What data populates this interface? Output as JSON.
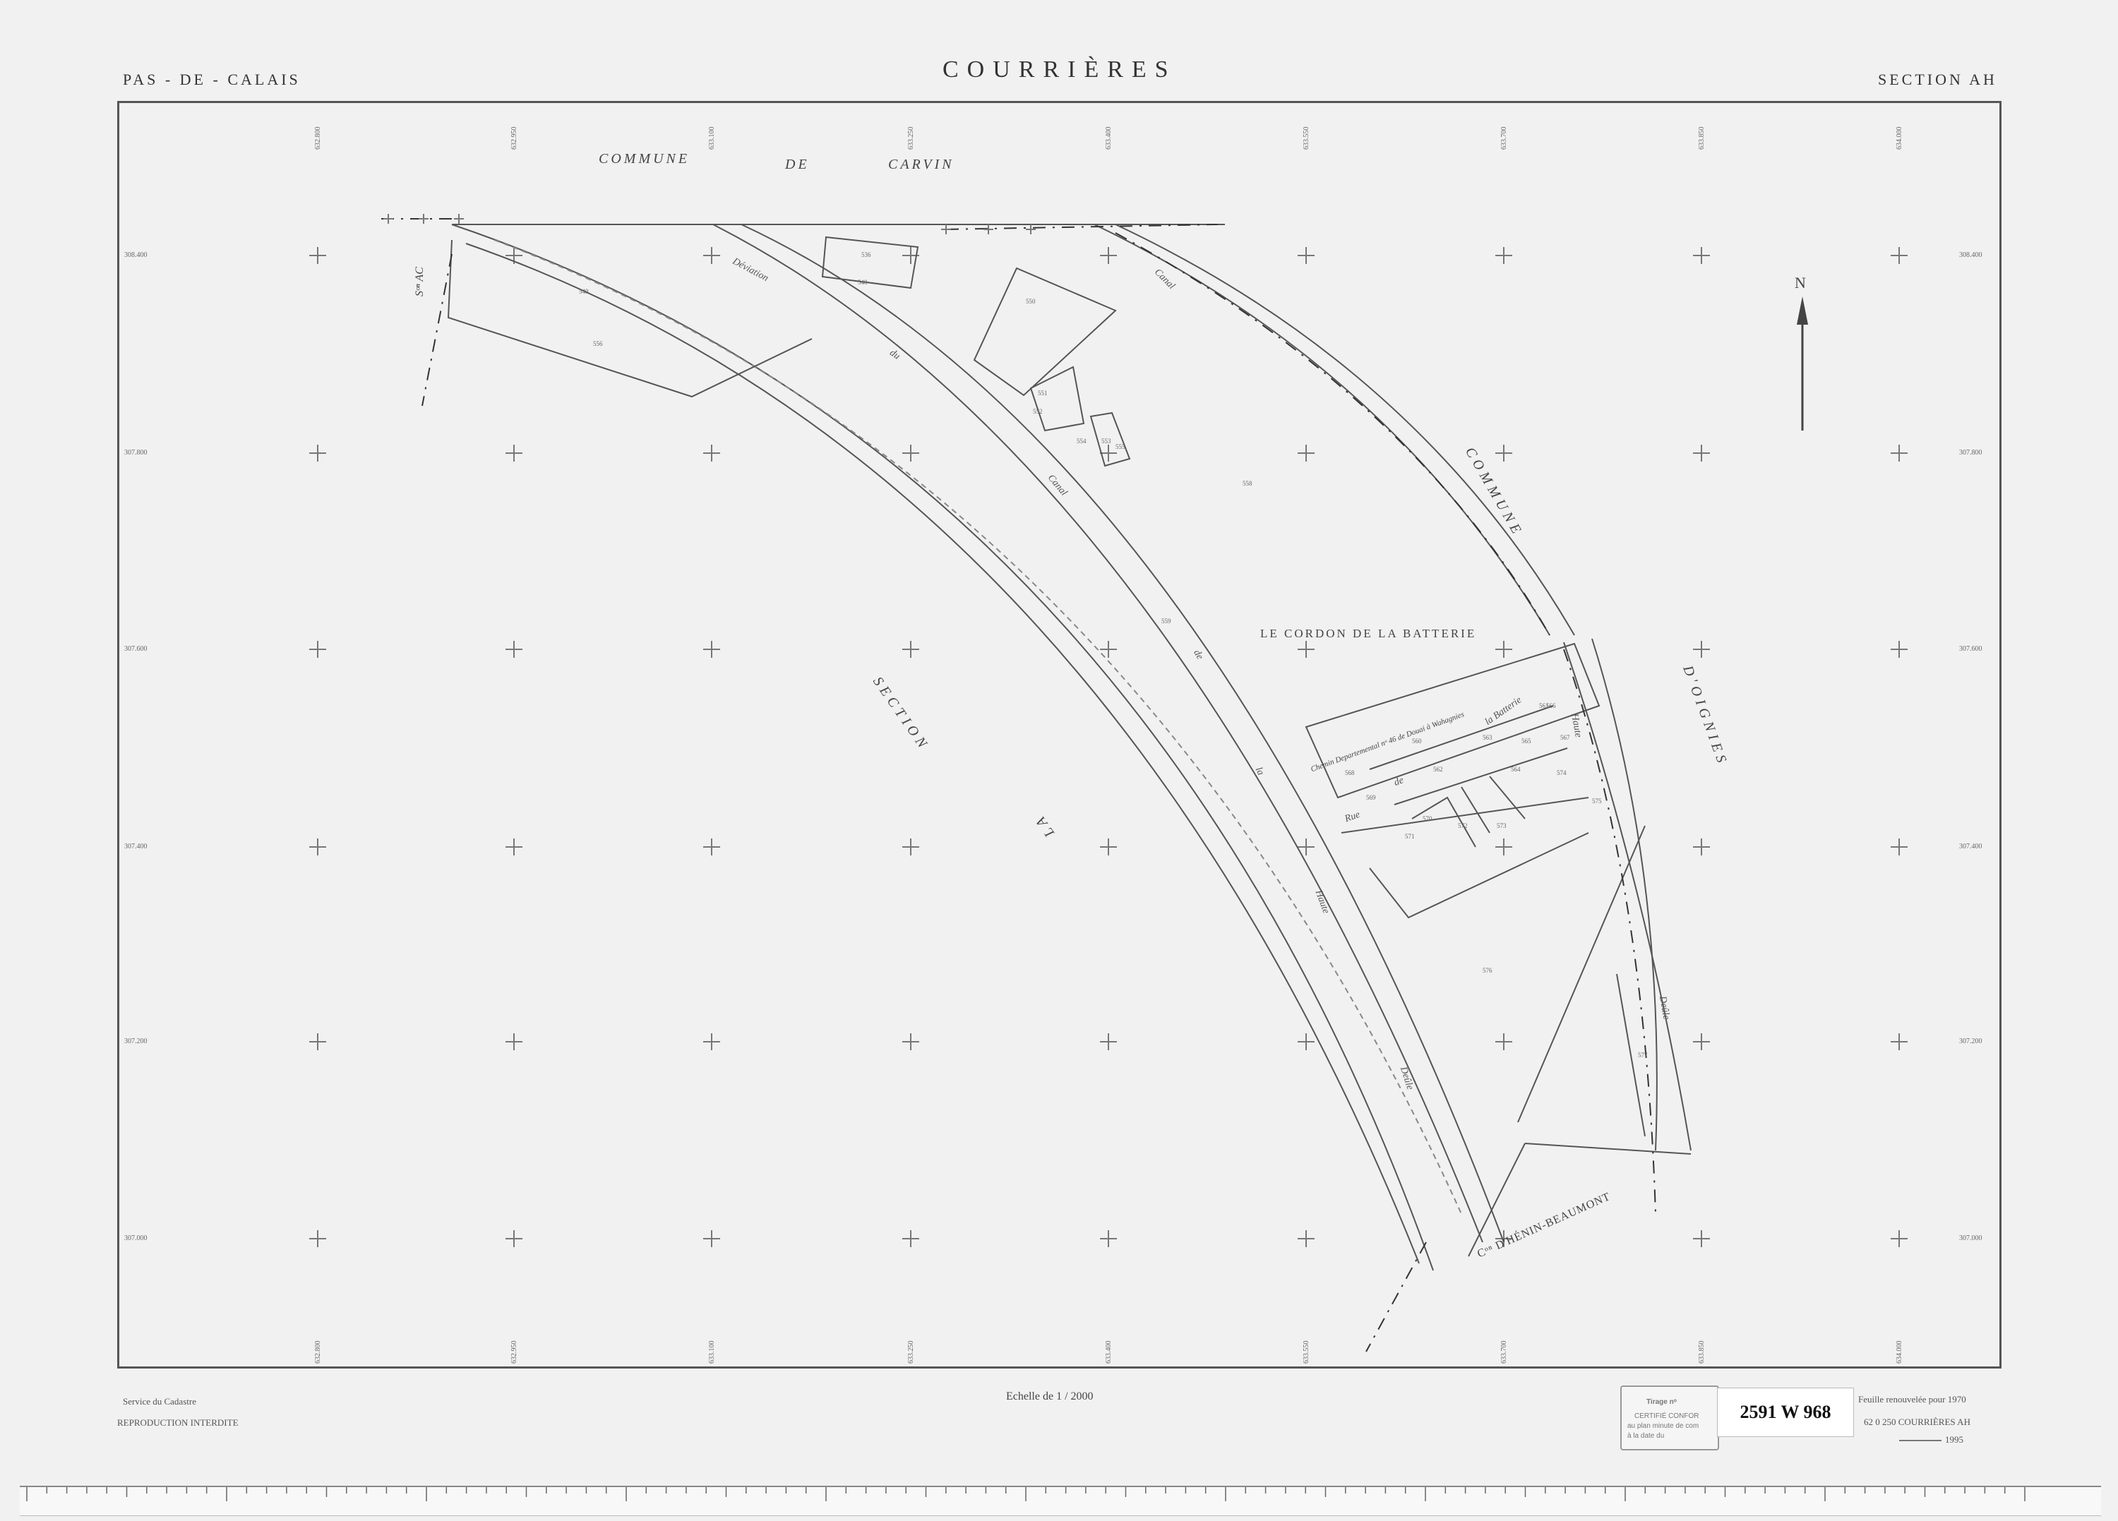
{
  "header": {
    "department": "PAS - DE - CALAIS",
    "title": "COURRIÈRES",
    "section": "SECTION  AH"
  },
  "labels": {
    "commune_carvin": [
      "COMMUNE",
      "DE",
      "CARVIN"
    ],
    "commune_oignies_1": "COMMUNE",
    "commune_oignies_2": "D'OIGNIES",
    "section_la": [
      "SECTION",
      "LA"
    ],
    "section_ac": "Sᵒⁿ AC",
    "deviation": "Déviation",
    "deviation_du": "du",
    "canal_top": "Canal",
    "canal_mid": "Canal",
    "canal_de": "de",
    "canal_la": "la",
    "haute": "Haute",
    "deule": "Deûle",
    "deule_right": "Deûle",
    "haute_right": "Haute",
    "cordon": "LE CORDON DE LA BATTERIE",
    "chemin": "Chemin  Departemental  nᵒ 46  de  Douai  à  Wahagnies",
    "rue": "Rue",
    "rue_de": "de",
    "batterie": "la Batterie",
    "henin": "Cᵒⁿ D'HÉNIN-BEAUMONT",
    "north": "N"
  },
  "parcels": [
    "536",
    "549",
    "548",
    "550",
    "551",
    "552",
    "553",
    "554",
    "555",
    "556",
    "558",
    "559",
    "560",
    "561",
    "562",
    "563",
    "564",
    "565",
    "566",
    "567",
    "568",
    "569",
    "570",
    "571",
    "572",
    "573",
    "574",
    "575",
    "576",
    "577"
  ],
  "coords": {
    "top": [
      "632.800",
      "632.950",
      "633.100",
      "633.250",
      "633.400",
      "633.550",
      "633.700",
      "633.850",
      "634.000"
    ],
    "bottom": [
      "632.800",
      "632.950",
      "633.100",
      "633.250",
      "633.400",
      "633.550",
      "633.700",
      "633.850",
      "634.000"
    ],
    "left": [
      "308.400",
      "307.800",
      "307.600",
      "307.400",
      "307.200",
      "307.000"
    ],
    "right": [
      "308.400",
      "307.800",
      "307.600",
      "307.400",
      "307.200",
      "307.000"
    ]
  },
  "footer": {
    "service": "Service  du  Cadastre",
    "reproduction": "REPRODUCTION  INTERDITE",
    "scale": "Echelle  de  1 / 2000",
    "renewal": "Feuille  renouvelée  pour  1970",
    "code": "62  0  250  COURRIÈRES   AH",
    "year": "1995",
    "tirage": "Tirage nᵒ",
    "certifie": "CERTIFIÉ CONFOR",
    "minute": "au plan minute de com",
    "date": "à la date du",
    "archive_stamp": "2591 W 968"
  },
  "colors": {
    "background": "#f1f1f2",
    "ink": "#555555",
    "frame": "#555555"
  }
}
